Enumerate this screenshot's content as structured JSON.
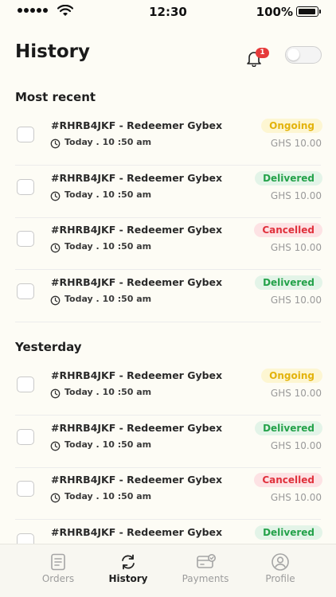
{
  "status_bar": {
    "time": "12:30",
    "battery": "100%"
  },
  "header": {
    "title": "History",
    "notification_count": "1"
  },
  "sections": [
    {
      "title": "Most recent",
      "orders": [
        {
          "title": "#RHRB4JKF - Redeemer Gybex",
          "time": "Today . 10 :50 am",
          "status": "Ongoing",
          "price": "GHS 10.00"
        },
        {
          "title": "#RHRB4JKF - Redeemer Gybex",
          "time": "Today . 10 :50 am",
          "status": "Delivered",
          "price": "GHS 10.00"
        },
        {
          "title": "#RHRB4JKF - Redeemer Gybex",
          "time": "Today . 10 :50 am",
          "status": "Cancelled",
          "price": "GHS 10.00"
        },
        {
          "title": "#RHRB4JKF - Redeemer Gybex",
          "time": "Today . 10 :50 am",
          "status": "Delivered",
          "price": "GHS 10.00"
        }
      ]
    },
    {
      "title": "Yesterday",
      "orders": [
        {
          "title": "#RHRB4JKF - Redeemer Gybex",
          "time": "Today . 10 :50 am",
          "status": "Ongoing",
          "price": "GHS 10.00"
        },
        {
          "title": "#RHRB4JKF - Redeemer Gybex",
          "time": "Today . 10 :50 am",
          "status": "Delivered",
          "price": "GHS 10.00"
        },
        {
          "title": "#RHRB4JKF - Redeemer Gybex",
          "time": "Today . 10 :50 am",
          "status": "Cancelled",
          "price": "GHS 10.00"
        },
        {
          "title": "#RHRB4JKF - Redeemer Gybex",
          "time": "",
          "status": "Delivered",
          "price": ""
        }
      ]
    }
  ],
  "tab_bar": {
    "tabs": [
      {
        "label": "Orders",
        "icon": "orders-icon",
        "active": false
      },
      {
        "label": "History",
        "icon": "history-icon",
        "active": true
      },
      {
        "label": "Payments",
        "icon": "payments-icon",
        "active": false
      },
      {
        "label": "Profile",
        "icon": "profile-icon",
        "active": false
      }
    ]
  },
  "colors": {
    "background": "#fdfcf5",
    "ongoing": "#e3b30c",
    "delivered": "#24a24a",
    "cancelled": "#e0313c",
    "badge": "#e63a3a"
  }
}
